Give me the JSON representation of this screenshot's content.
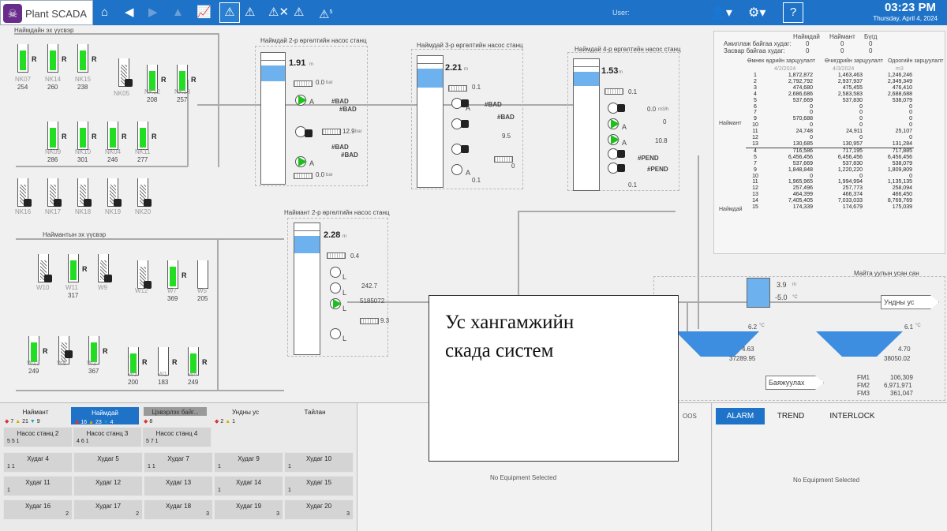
{
  "app": {
    "title": "Plant SCADA"
  },
  "topbar": {
    "user_label": "User:",
    "time": "03:23 PM",
    "date": "Thursday, April 4, 2024",
    "alarm_badge": "5"
  },
  "process": {
    "well_header_nk": "Наймдайн эх үүсвэр",
    "well_header_w": "Наймантын эх үүсвэр",
    "station2_title": "Наймдай 2-р өргөлтийн насос станц",
    "station3_title": "Наймдай 3-р өргөлтийн насос станц",
    "station4_title": "Наймдай 4-р өргөлтийн насос станц",
    "stationW2_title": "Наймант 2-р өргөлтийн насос станц",
    "reservoir_title": "Майта уулын усан сан",
    "wells_row1": [
      {
        "name": "NK07",
        "hours": "254"
      },
      {
        "name": "NK14",
        "hours": "260"
      },
      {
        "name": "NK15",
        "hours": "238"
      },
      {
        "name": "NK05",
        "hours": ""
      },
      {
        "name": "NK12",
        "hours": "208"
      },
      {
        "name": "NK13",
        "hours": "257"
      }
    ],
    "wells_row2": [
      {
        "name": "NK09",
        "hours": "286"
      },
      {
        "name": "NK10",
        "hours": "301"
      },
      {
        "name": "NK04",
        "hours": "246"
      },
      {
        "name": "NK11",
        "hours": "277"
      }
    ],
    "wells_row3": [
      "NK16",
      "NK17",
      "NK18",
      "NK19",
      "NK20"
    ],
    "wells_w1": [
      {
        "name": "W10",
        "hours": ""
      },
      {
        "name": "W11",
        "hours": "317"
      },
      {
        "name": "W9",
        "hours": ""
      },
      {
        "name": "W12",
        "hours": ""
      },
      {
        "name": "W7",
        "hours": "369"
      },
      {
        "name": "W5",
        "hours": "205"
      }
    ],
    "wells_w2": [
      {
        "name": "W13",
        "hours": "249"
      },
      {
        "name": "W8",
        "hours": ""
      },
      {
        "name": "W2",
        "hours": "367"
      },
      {
        "name": "W3",
        "hours": "200"
      },
      {
        "name": "W1",
        "hours": "183"
      },
      {
        "name": "W4",
        "hours": "249"
      }
    ],
    "hours_unit": "h",
    "st2_level": "1.91",
    "st2_p1": "0.0",
    "st2_bad1": "#BAD",
    "st2_bad2": "#BAD",
    "st2_p2": "12.9",
    "st2_bad3": "#BAD",
    "st2_bad4": "#BAD",
    "st2_p3": "0.0",
    "st3_level": "2.21",
    "st3_p1": "0.1",
    "st3_bad1": "#BAD",
    "st3_bad2": "#BAD",
    "st3_p2": "9.5",
    "st3_p3": "0",
    "st3_p4": "0.1",
    "st4_level": "1.53",
    "st4_p1": "0.1",
    "st4_f1": "0.0",
    "st4_f2": "0",
    "st4_p2": "10.8",
    "st4_pend1": "#PEND",
    "st4_pend2": "#PEND",
    "st4_p3": "0.1",
    "w2_level": "2.28",
    "w2_p1": "0.4",
    "w2_flow": "242.7",
    "w2_total": "5185072",
    "w2_p2": "9.3",
    "res_level": "3.9",
    "res_temp": "-5.0",
    "res_t1": "6.2",
    "res_t2": "6.1",
    "res_l1": "4.63",
    "res_l2": "4.70",
    "res_v1": "37289.95",
    "res_v2": "38050.02",
    "fm1_label": "FM1",
    "fm2_label": "FM2",
    "fm3_label": "FM3",
    "fm1": "106,309",
    "fm2": "6,971,971",
    "fm3": "361,047",
    "out_label": "Ундны ус",
    "dist_label": "Баяжуулах",
    "unit_m": "m",
    "unit_m3": "m3",
    "unit_bar": "bar",
    "unit_c": "°C",
    "unit_m3h": "m3/h",
    "pump_a": "A",
    "pump_l": "L",
    "well_r": "R"
  },
  "flow_table": {
    "hdr_cols": [
      "Наймдай",
      "Наймант",
      "Бүгд"
    ],
    "row_active": "Ажиллаж байгаа худаг:",
    "row_repair": "Засвар байгаа худаг:",
    "active_vals": [
      "0",
      "0",
      "0"
    ],
    "repair_vals": [
      "0",
      "0",
      "0"
    ],
    "col1": "Өмнөх өдрийн зарцуулалт",
    "col2": "Өчигдрийн зарцуулалт",
    "col3": "Одоогийн зарцуулалт",
    "dates": [
      "4/2/2024",
      "4/3/2024",
      "m3"
    ],
    "group_naimant": "Наймант",
    "group_naimdai": "Наймдай",
    "naimant_rows": [
      [
        "1",
        "1,872,872",
        "1,463,463",
        "1,246,246"
      ],
      [
        "2",
        "2,792,792",
        "2,937,937",
        "2,349,349"
      ],
      [
        "3",
        "474,680",
        "475,455",
        "476,410"
      ],
      [
        "4",
        "2,686,686",
        "2,583,583",
        "2,688,688"
      ],
      [
        "5",
        "537,669",
        "537,830",
        "538,079"
      ],
      [
        "6",
        "0",
        "0",
        "0"
      ],
      [
        "7",
        "0",
        "0",
        "0"
      ],
      [
        "9",
        "570,688",
        "0",
        "0"
      ],
      [
        "10",
        "0",
        "0",
        "0"
      ],
      [
        "11",
        "24,748",
        "24,911",
        "25,107"
      ],
      [
        "12",
        "0",
        "0",
        "0"
      ],
      [
        "13",
        "130,685",
        "130,957",
        "131,284"
      ]
    ],
    "naimdai_rows": [
      [
        "4",
        "716,586",
        "717,195",
        "717,885"
      ],
      [
        "5",
        "6,456,456",
        "6,456,456",
        "6,456,456"
      ],
      [
        "7",
        "537,669",
        "537,830",
        "538,079"
      ],
      [
        "9",
        "1,848,848",
        "1,220,220",
        "1,809,809"
      ],
      [
        "10",
        "0",
        "0",
        "0"
      ],
      [
        "11",
        "1,965,965",
        "1,994,994",
        "1,135,135"
      ],
      [
        "12",
        "257,496",
        "257,773",
        "258,094"
      ],
      [
        "13",
        "464,399",
        "466,374",
        "466,450"
      ],
      [
        "14",
        "7,405,405",
        "7,033,033",
        "8,769,769"
      ],
      [
        "15",
        "174,339",
        "174,679",
        "175,039"
      ]
    ]
  },
  "overlay": {
    "line1": "Ус хангамжийн",
    "line2": "скада систем"
  },
  "bottom": {
    "tabs": [
      {
        "label": "Наймант",
        "s1": "7",
        "s2": "21",
        "s3": "9"
      },
      {
        "label": "Наймдай",
        "s1": "16",
        "s2": "23",
        "s3": "4"
      },
      {
        "label": "Цэвэрлэх байг...",
        "s1": "8"
      },
      {
        "label": "Ундны ус",
        "s1": "2",
        "s2": "1"
      },
      {
        "label": "Тайлан"
      }
    ],
    "cards": [
      {
        "label": "Насос станц 2",
        "s": "5  5  1"
      },
      {
        "label": "Насос станц 3",
        "s": "4  6  1"
      },
      {
        "label": "Насос станц 4",
        "s": "5  7  1"
      },
      {
        "label": "Худаг 4",
        "s": "1  1"
      },
      {
        "label": "Худаг 5",
        "s": ""
      },
      {
        "label": "Худаг 7",
        "s": "1  1"
      },
      {
        "label": "Худаг 9",
        "s": "1"
      },
      {
        "label": "Худаг 10",
        "s": "1"
      },
      {
        "label": "Худаг 11",
        "s": "1"
      },
      {
        "label": "Худаг 12",
        "s": ""
      },
      {
        "label": "Худаг 13",
        "s": ""
      },
      {
        "label": "Худаг 14",
        "s": "1"
      },
      {
        "label": "Худаг 15",
        "s": "1"
      },
      {
        "label": "Худаг 16",
        "r": "2"
      },
      {
        "label": "Худаг 17",
        "r": "2"
      },
      {
        "label": "Худаг 18",
        "r": "3"
      },
      {
        "label": "Худаг 19",
        "r": "3"
      },
      {
        "label": "Худаг 20",
        "r": "3"
      }
    ],
    "oos": "OOS",
    "no_equipment": "No Equipment Selected",
    "right_tabs": [
      "ALARM",
      "TREND",
      "INTERLOCK"
    ]
  }
}
